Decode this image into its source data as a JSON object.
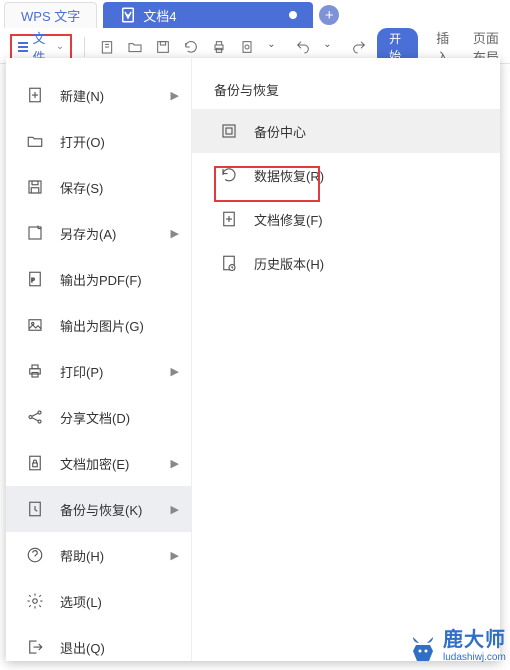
{
  "tabs": {
    "app": "WPS 文字",
    "doc": "文档4"
  },
  "file_button": "文件",
  "ribbon": {
    "start": "开始",
    "insert": "插入",
    "layout": "页面布局"
  },
  "left_menu": [
    {
      "label": "新建(N)",
      "arrow": true
    },
    {
      "label": "打开(O)",
      "arrow": false
    },
    {
      "label": "保存(S)",
      "arrow": false
    },
    {
      "label": "另存为(A)",
      "arrow": true
    },
    {
      "label": "输出为PDF(F)",
      "arrow": false
    },
    {
      "label": "输出为图片(G)",
      "arrow": false
    },
    {
      "label": "打印(P)",
      "arrow": true
    },
    {
      "label": "分享文档(D)",
      "arrow": false
    },
    {
      "label": "文档加密(E)",
      "arrow": true
    },
    {
      "label": "备份与恢复(K)",
      "arrow": true
    },
    {
      "label": "帮助(H)",
      "arrow": true
    },
    {
      "label": "选项(L)",
      "arrow": false
    },
    {
      "label": "退出(Q)",
      "arrow": false
    }
  ],
  "right_panel": {
    "title": "备份与恢复",
    "items": [
      "备份中心",
      "数据恢复(R)",
      "文档修复(F)",
      "历史版本(H)"
    ]
  },
  "watermark": {
    "name": "鹿大师",
    "url": "ludashiwj.com"
  }
}
